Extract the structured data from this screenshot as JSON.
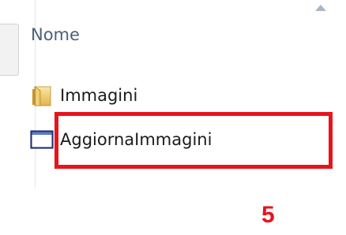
{
  "file_list": {
    "column_header": "Nome",
    "items": [
      {
        "name": "Immagini",
        "icon": "folder-icon"
      },
      {
        "name": "AggiornaImmagini",
        "icon": "application-window-icon"
      }
    ]
  },
  "annotation": {
    "step_label": "5",
    "highlight_color": "#e8141c"
  },
  "colors": {
    "header_text": "#4c607a",
    "folder": "#e8c25a",
    "app_icon_border": "#1f2e7a"
  }
}
